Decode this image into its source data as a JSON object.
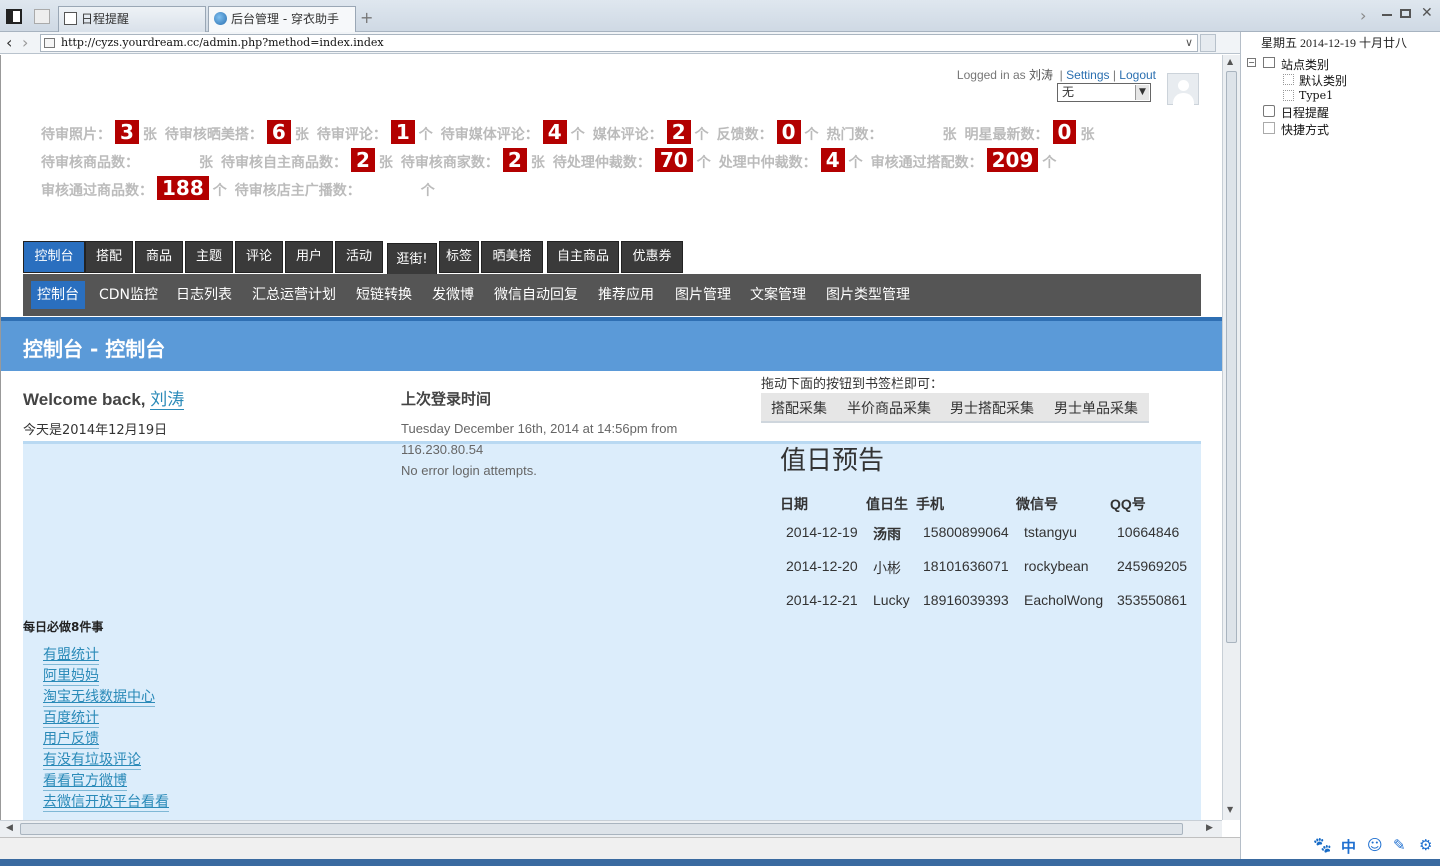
{
  "browser": {
    "tabs": [
      {
        "label": "日程提醒"
      },
      {
        "label": "后台管理 - 穿衣助手"
      }
    ],
    "new_tab": "+",
    "url": "http://cyzs.yourdream.cc/admin.php?method=index.index"
  },
  "sidepanel": {
    "date": "星期五 2014-12-19 十月廿八",
    "tree": [
      "站点类别",
      "默认类别",
      "Type1",
      "日程提醒",
      "快捷方式"
    ]
  },
  "header": {
    "logged_in_prefix": "Logged in as",
    "user": "刘涛",
    "settings": "Settings",
    "logout": "Logout",
    "select_value": "无"
  },
  "stats": [
    {
      "label": "待审照片：",
      "value": "3",
      "unit": "张"
    },
    {
      "label": "待审核晒美搭：",
      "value": "6",
      "unit": "张"
    },
    {
      "label": "待审评论：",
      "value": "1",
      "unit": "个"
    },
    {
      "label": "待审媒体评论：",
      "value": "4",
      "unit": "个"
    },
    {
      "label": "媒体评论：",
      "value": "2",
      "unit": "个"
    },
    {
      "label": "反馈数：",
      "value": "0",
      "unit": "个"
    },
    {
      "label": "热门数：",
      "value": "",
      "unit": "张"
    },
    {
      "label": "明星最新数：",
      "value": "0",
      "unit": "张"
    },
    {
      "label": "待审核商品数：",
      "value": "",
      "unit": "张"
    },
    {
      "label": "待审核自主商品数：",
      "value": "2",
      "unit": "张"
    },
    {
      "label": "待审核商家数：",
      "value": "2",
      "unit": "张"
    },
    {
      "label": "待处理仲裁数：",
      "value": "70",
      "unit": "个"
    },
    {
      "label": "处理中仲裁数：",
      "value": "4",
      "unit": "个"
    },
    {
      "label": "审核通过搭配数：",
      "value": "209",
      "unit": "个"
    },
    {
      "label": "审核通过商品数：",
      "value": "188",
      "unit": "个"
    },
    {
      "label": "待审核店主广播数：",
      "value": "",
      "unit": "个"
    }
  ],
  "main_nav": [
    "控制台",
    "搭配",
    "商品",
    "主题",
    "评论",
    "用户",
    "活动",
    "逛街!",
    "标签",
    "晒美搭",
    "自主商品",
    "优惠券"
  ],
  "sub_nav": [
    "控制台",
    "CDN监控",
    "日志列表",
    "汇总运营计划",
    "短链转换",
    "发微博",
    "微信自动回复",
    "推荐应用",
    "图片管理",
    "文案管理",
    "图片类型管理"
  ],
  "page_title": "控制台 - 控制台",
  "welcome": {
    "prefix": "Welcome back,",
    "user": "刘涛",
    "today": "今天是2014年12月19日"
  },
  "last_login": {
    "heading": "上次登录时间",
    "time": "Tuesday December 16th, 2014 at 14:56pm from",
    "ip": "116.230.80.54",
    "errors": "No error login attempts."
  },
  "bookmarks": {
    "heading": "拖动下面的按钮到书签栏即可：",
    "items": [
      "搭配采集",
      "半价商品采集",
      "男士搭配采集",
      "男士单品采集"
    ]
  },
  "duty": {
    "heading": "值日预告",
    "columns": [
      "日期",
      "值日生",
      "手机",
      "微信号",
      "QQ号"
    ],
    "rows": [
      [
        "2014-12-19",
        "汤雨",
        "15800899064",
        "tstangyu",
        "10664846"
      ],
      [
        "2014-12-20",
        "小彬",
        "18101636071",
        "rockybean",
        "245969205"
      ],
      [
        "2014-12-21",
        "Lucky",
        "18916039393",
        "EacholWong",
        "353550861"
      ]
    ]
  },
  "daily": {
    "heading": "每日必做8件事",
    "links": [
      "有盟统计",
      "阿里妈妈",
      "淘宝无线数据中心",
      "百度统计",
      "用户反馈",
      "有没有垃圾评论",
      "看看官方微博",
      "去微信开放平台看看"
    ]
  }
}
